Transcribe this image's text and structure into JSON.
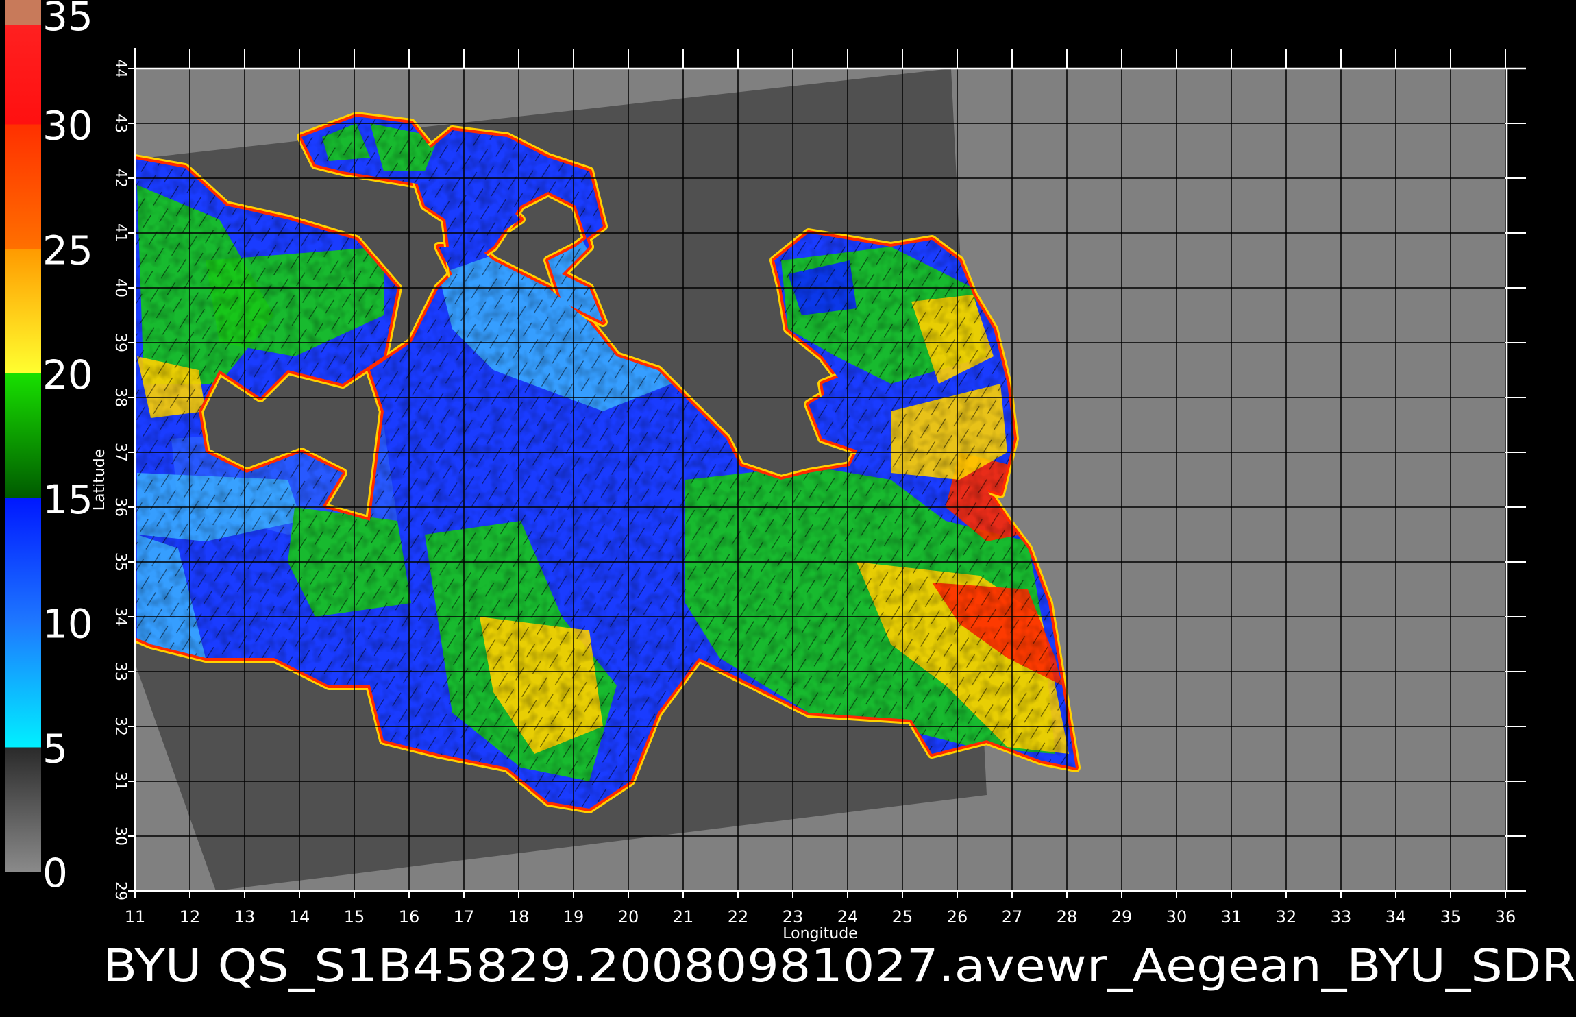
{
  "map": {
    "caption": "BYU  QS_S1B45829.20080981027.avewr_Aegean_BYU_SDR",
    "x_axis_label": "Longitude",
    "y_axis_label": "Latitude",
    "lon_ticks": [
      "11",
      "12",
      "13",
      "14",
      "15",
      "16",
      "17",
      "18",
      "19",
      "20",
      "21",
      "22",
      "23",
      "24",
      "25",
      "26",
      "27",
      "28",
      "29",
      "30",
      "31",
      "32",
      "33",
      "34",
      "35",
      "36"
    ],
    "lat_ticks": [
      "29",
      "30",
      "31",
      "32",
      "33",
      "34",
      "35",
      "36",
      "37",
      "38",
      "39",
      "40",
      "41",
      "42",
      "43",
      "44"
    ],
    "lon_range": [
      11,
      36
    ],
    "lat_range": [
      29,
      44
    ],
    "grid": true
  },
  "colorbar": {
    "labels": [
      "0",
      "5",
      "10",
      "15",
      "20",
      "25",
      "30",
      "35"
    ],
    "stops": [
      {
        "value": 0,
        "color": "#8a8a8a"
      },
      {
        "value": 5,
        "color": "#2a2a2a"
      },
      {
        "value": 5,
        "color": "#00f0ff"
      },
      {
        "value": 10,
        "color": "#1e78ff"
      },
      {
        "value": 15,
        "color": "#0018ff"
      },
      {
        "value": 15,
        "color": "#005a00"
      },
      {
        "value": 20,
        "color": "#18e000"
      },
      {
        "value": 20,
        "color": "#ffff30"
      },
      {
        "value": 25,
        "color": "#ff9a00"
      },
      {
        "value": 25,
        "color": "#ff7000"
      },
      {
        "value": 30,
        "color": "#ff3000"
      },
      {
        "value": 30,
        "color": "#ff1010"
      },
      {
        "value": 34,
        "color": "#ff2020"
      },
      {
        "value": 34,
        "color": "#c87a5a"
      },
      {
        "value": 35,
        "color": "#c87a5a"
      }
    ]
  },
  "colors": {
    "background": "#000000",
    "outside_swath": "#808080",
    "land_in_swath": "#505050",
    "grid": "#000000",
    "axis": "#ffffff",
    "sea_low": "#1a3cff",
    "sea_calm": "#3aa8ff",
    "sea_mid": "#18c818",
    "sea_high": "#ffd000",
    "sea_max": "#ff2a00",
    "coast_fringe": "#ff00ff"
  }
}
